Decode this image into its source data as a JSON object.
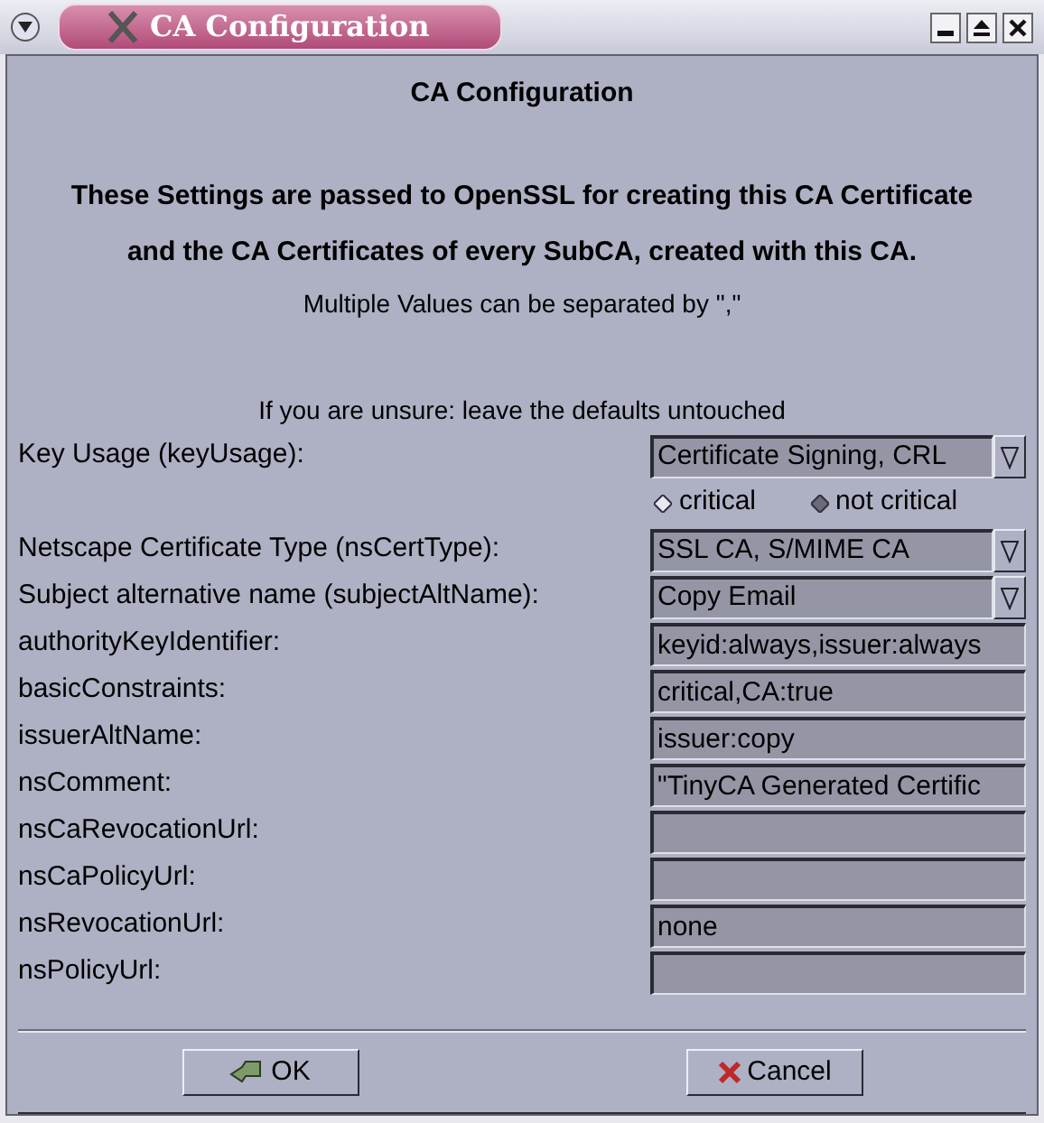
{
  "window": {
    "title": "CA Configuration"
  },
  "heading": "CA Configuration",
  "intro_lines": [
    "These Settings are passed to OpenSSL for creating this CA Certificate",
    "and the CA Certificates of every SubCA, created with this CA."
  ],
  "note": "Multiple Values can be separated by \",\"",
  "hint": "If you are unsure: leave the defaults untouched",
  "rows": [
    {
      "kind": "combo",
      "label": "Key Usage (keyUsage):",
      "value": "Certificate Signing, CRL"
    },
    {
      "kind": "radios",
      "options": [
        {
          "label": "critical",
          "selected": false
        },
        {
          "label": "not critical",
          "selected": true
        }
      ]
    },
    {
      "kind": "combo",
      "label": "Netscape Certificate Type (nsCertType):",
      "value": "SSL CA, S/MIME CA"
    },
    {
      "kind": "combo",
      "label": "Subject alternative name (subjectAltName):",
      "value": "Copy Email"
    },
    {
      "kind": "text",
      "label": "authorityKeyIdentifier:",
      "value": "keyid:always,issuer:always"
    },
    {
      "kind": "text",
      "label": "basicConstraints:",
      "value": "critical,CA:true"
    },
    {
      "kind": "text",
      "label": "issuerAltName:",
      "value": "issuer:copy"
    },
    {
      "kind": "text",
      "label": "nsComment:",
      "value": "\"TinyCA Generated Certific"
    },
    {
      "kind": "text",
      "label": "nsCaRevocationUrl:",
      "value": ""
    },
    {
      "kind": "text",
      "label": "nsCaPolicyUrl:",
      "value": ""
    },
    {
      "kind": "text",
      "label": "nsRevocationUrl:",
      "value": "none"
    },
    {
      "kind": "text",
      "label": "nsPolicyUrl:",
      "value": ""
    }
  ],
  "buttons": [
    {
      "kind": "ok",
      "label": "OK"
    },
    {
      "kind": "cancel",
      "label": "Cancel"
    }
  ]
}
